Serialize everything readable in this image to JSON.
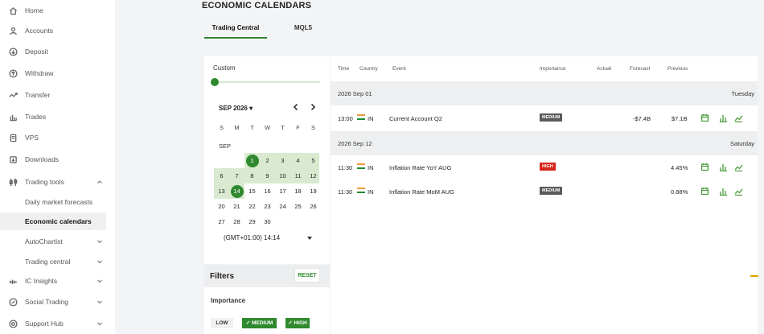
{
  "sidebar": {
    "items": [
      {
        "label": "Home",
        "icon": "home-icon"
      },
      {
        "label": "Accounts",
        "icon": "user-icon"
      },
      {
        "label": "Deposit",
        "icon": "deposit-icon"
      },
      {
        "label": "Withdraw",
        "icon": "withdraw-icon"
      },
      {
        "label": "Transfer",
        "icon": "transfer-icon"
      },
      {
        "label": "Trades",
        "icon": "trades-icon"
      },
      {
        "label": "VPS",
        "icon": "server-icon"
      },
      {
        "label": "Downloads",
        "icon": "download-icon"
      },
      {
        "label": "Trading tools",
        "icon": "tools-icon"
      },
      {
        "label": "Daily market forecasts"
      },
      {
        "label": "Economic calendars"
      },
      {
        "label": "AutoChartist"
      },
      {
        "label": "Trading central"
      },
      {
        "label": "IC Insights",
        "icon": "insights-icon"
      },
      {
        "label": "Social Trading",
        "icon": "social-icon"
      },
      {
        "label": "Support Hub",
        "icon": "support-icon"
      }
    ]
  },
  "page": {
    "title": "ECONOMIC CALENDARS",
    "tabs": [
      {
        "label": "Trading Central",
        "active": true
      },
      {
        "label": "MQL5",
        "active": false
      }
    ]
  },
  "calendar": {
    "range_label": "Custom",
    "month_label": "SEP 2026",
    "weekdays": [
      "S",
      "M",
      "T",
      "W",
      "T",
      "F",
      "S"
    ],
    "month_short": "SEP",
    "weeks": [
      [
        "",
        "",
        "1",
        "2",
        "3",
        "4",
        "5"
      ],
      [
        "6",
        "7",
        "8",
        "9",
        "10",
        "11",
        "12"
      ],
      [
        "13",
        "14",
        "15",
        "16",
        "17",
        "18",
        "19"
      ],
      [
        "20",
        "21",
        "22",
        "23",
        "24",
        "25",
        "26"
      ],
      [
        "27",
        "28",
        "29",
        "30",
        "",
        "",
        ""
      ]
    ],
    "range_start": 1,
    "range_end": 14,
    "timezone": "(GMT+01:00) 14:14"
  },
  "filters": {
    "title": "Filters",
    "reset_label": "RESET",
    "importance_label": "Importance",
    "chips": [
      {
        "label": "LOW",
        "checked": false
      },
      {
        "label": "✓ MEDIUM",
        "checked": true
      },
      {
        "label": "✓ HIGH",
        "checked": true
      }
    ]
  },
  "table": {
    "headers": {
      "time": "Time",
      "country": "Country",
      "event": "Event",
      "importance": "Importance",
      "actual": "Actual",
      "forecast": "Forecast",
      "previous": "Previous"
    },
    "groups": [
      {
        "date": "2026 Sep 01",
        "weekday": "Tuesday",
        "events": [
          {
            "time": "13:00",
            "country": "IN",
            "event": "Current Account Q2",
            "importance": "MEDIUM",
            "actual": "",
            "forecast": "-$7.4B",
            "previous": "$7.1B"
          }
        ]
      },
      {
        "date": "2026 Sep 12",
        "weekday": "Saturday",
        "events": [
          {
            "time": "11:30",
            "country": "IN",
            "event": "Inflation Rate YoY AUG",
            "importance": "HIGH",
            "actual": "",
            "forecast": "",
            "previous": "4.45%"
          },
          {
            "time": "11:30",
            "country": "IN",
            "event": "Inflation Rate MoM AUG",
            "importance": "MEDIUM",
            "actual": "",
            "forecast": "",
            "previous": "0.88%"
          }
        ]
      }
    ]
  },
  "colors": {
    "accent": "#2f8a2f",
    "range_band": "#d9ead0",
    "badge_medium": "#5a5a5a",
    "badge_high": "#d8261c",
    "action_icon": "#4a9a3c"
  }
}
